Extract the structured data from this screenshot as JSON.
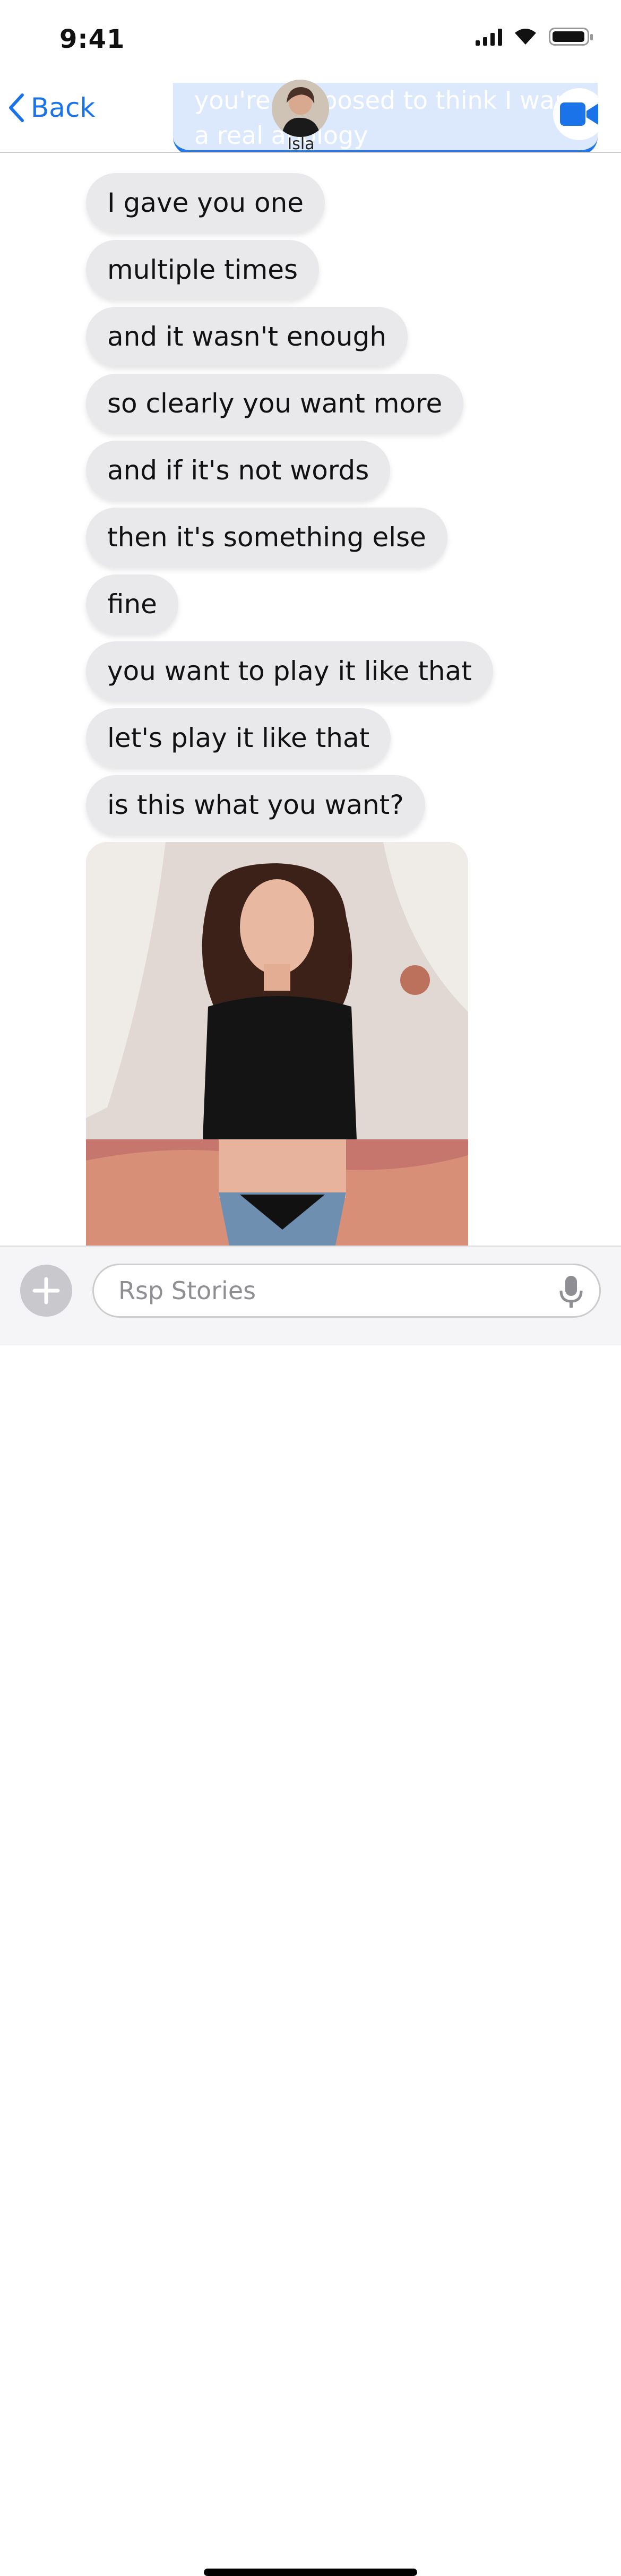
{
  "status_bar": {
    "time": "9:41"
  },
  "nav": {
    "back_label": "Back",
    "contact_name": "Isla",
    "previous_message": "you're supposed to think I want a real apology",
    "icons": [
      "chevron-left-icon",
      "video-camera-icon"
    ]
  },
  "messages": [
    "I gave you one",
    "multiple times",
    "and it wasn't enough",
    "so clearly you want more",
    "and if it's not words",
    "then it's something else",
    "fine",
    "you want to play it like that",
    "let's play it like that",
    "is this what you want?"
  ],
  "composer": {
    "placeholder": "Rsp Stories"
  },
  "colors": {
    "accent": "#1a73e8",
    "bubble": "#e9e9eb"
  }
}
